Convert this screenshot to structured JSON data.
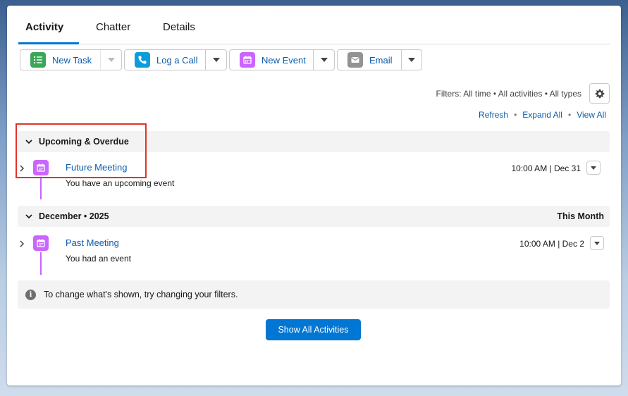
{
  "tabs": [
    {
      "label": "Activity",
      "active": true
    },
    {
      "label": "Chatter",
      "active": false
    },
    {
      "label": "Details",
      "active": false
    }
  ],
  "actions": {
    "new_task": "New Task",
    "log_call": "Log a Call",
    "new_event": "New Event",
    "email": "Email"
  },
  "filters": {
    "text": "Filters: All time • All activities • All types"
  },
  "links": {
    "refresh": "Refresh",
    "expand_all": "Expand All",
    "view_all": "View All",
    "separator": "•"
  },
  "sections": [
    {
      "title": "Upcoming & Overdue",
      "right": "",
      "items": [
        {
          "title": "Future Meeting",
          "subtitle": "You have an upcoming event",
          "time": "10:00 AM | Dec 31"
        }
      ]
    },
    {
      "title": "December • 2025",
      "right": "This Month",
      "items": [
        {
          "title": "Past Meeting",
          "subtitle": "You had an event",
          "time": "10:00 AM | Dec 2"
        }
      ]
    }
  ],
  "info": {
    "icon_glyph": "i",
    "text": "To change what's shown, try changing your filters."
  },
  "show_all_label": "Show All Activities",
  "colors": {
    "brand": "#0176d3",
    "link": "#0b5cab",
    "event": "#cb65ff",
    "task": "#3ba755",
    "call": "#0d9dda",
    "email": "#939393",
    "highlight": "#e0342b"
  },
  "icons": {
    "task": "task-list-icon",
    "call": "phone-icon",
    "event": "calendar-icon",
    "email": "envelope-icon",
    "settings": "gear-icon",
    "info": "info-icon"
  }
}
